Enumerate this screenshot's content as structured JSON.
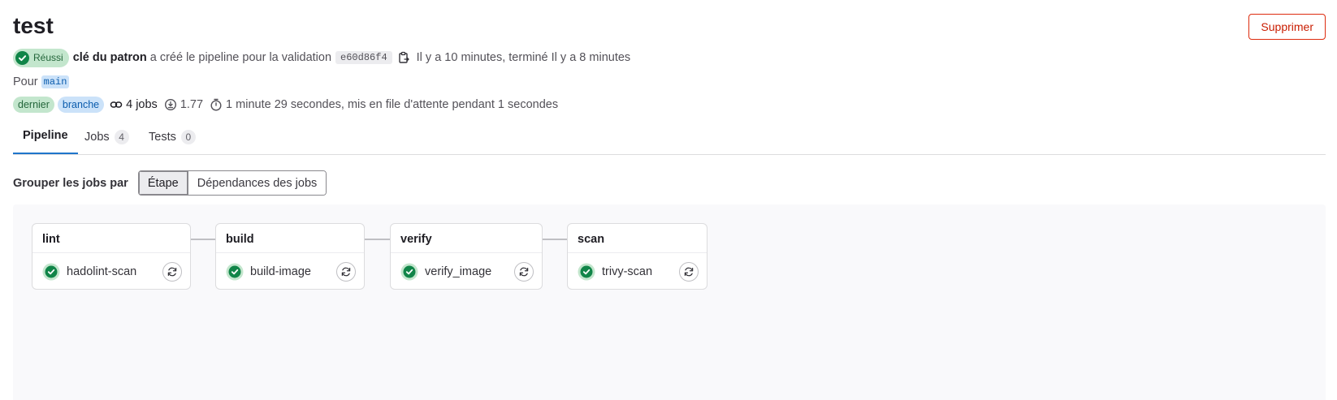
{
  "pipeline": {
    "title": "test",
    "delete_label": "Supprimer"
  },
  "status": {
    "badge": "Réussi",
    "color": "#108548"
  },
  "meta": {
    "author": "clé du patron",
    "action_text": "a créé le pipeline pour la validation",
    "commit_sha": "e60d86f4",
    "time_text": "Il y a 10 minutes, terminé Il y a 8 minutes",
    "for_label": "Pour",
    "ref": "main",
    "badges": [
      "dernier",
      "branche"
    ],
    "jobs_count": "4 jobs",
    "compute": "1.77",
    "duration_text": "1 minute 29 secondes, mis en file d'attente pendant 1 secondes"
  },
  "tabs": [
    {
      "label": "Pipeline"
    },
    {
      "label": "Jobs",
      "count": "4"
    },
    {
      "label": "Tests",
      "count": "0"
    }
  ],
  "group_by": {
    "label": "Grouper les jobs par",
    "options": [
      "Étape",
      "Dépendances des jobs"
    ],
    "selected": "Étape"
  },
  "stages": [
    {
      "name": "lint",
      "job": "hadolint-scan"
    },
    {
      "name": "build",
      "job": "build-image"
    },
    {
      "name": "verify",
      "job": "verify_image"
    },
    {
      "name": "scan",
      "job": "trivy-scan"
    }
  ],
  "icons": {
    "status": "check-circle-icon",
    "copy": "clipboard-icon",
    "jobs": "link-icon",
    "compute": "compute-icon",
    "duration": "timer-icon",
    "retry": "retry-icon"
  }
}
